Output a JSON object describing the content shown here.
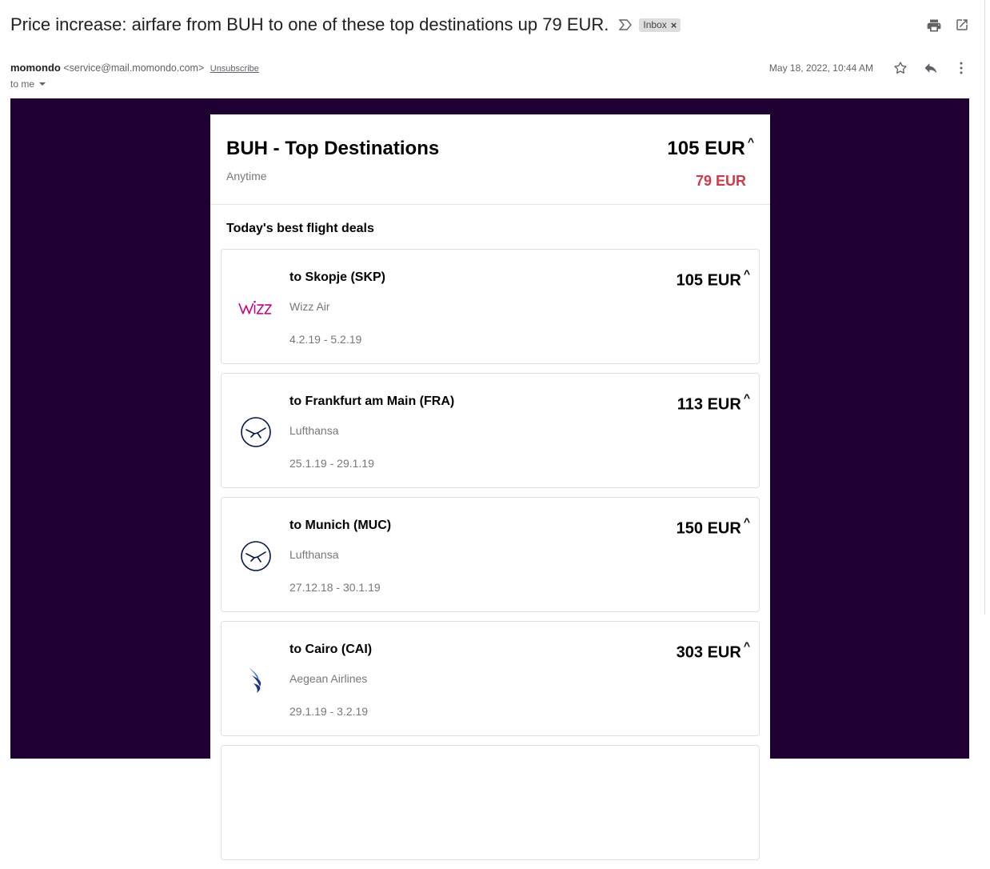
{
  "email": {
    "subject": "Price increase: airfare from BUH to one of these top destinations up 79 EUR.",
    "label_chip": "Inbox",
    "label_close": "×",
    "sender_name": "momondo",
    "sender_email": "<service@mail.momondo.com>",
    "unsubscribe": "Unsubscribe",
    "to": "to me",
    "date": "May 18, 2022, 10:44 AM",
    "icons": [
      "important-marker-icon",
      "print-icon",
      "open-new-window-icon",
      "star-icon",
      "reply-icon",
      "more-vert-icon"
    ]
  },
  "alert": {
    "title": "BUH - Top Destinations",
    "subtitle": "Anytime",
    "price": "105 EUR",
    "price_arrow": "^",
    "old_price": "79 EUR",
    "section_title": "Today's best flight deals",
    "colors": {
      "background": "#200033",
      "old_price": "#d03a48"
    }
  },
  "deals": [
    {
      "destination": "to Skopje (SKP)",
      "airline": "Wizz Air",
      "dates": "4.2.19 - 5.2.19",
      "price": "105 EUR",
      "arrow": "^",
      "logo": "wizz-air-logo"
    },
    {
      "destination": "to Frankfurt am Main (FRA)",
      "airline": "Lufthansa",
      "dates": "25.1.19 - 29.1.19",
      "price": "113 EUR",
      "arrow": "^",
      "logo": "lufthansa-logo"
    },
    {
      "destination": "to Munich (MUC)",
      "airline": "Lufthansa",
      "dates": "27.12.18 - 30.1.19",
      "price": "150 EUR",
      "arrow": "^",
      "logo": "lufthansa-logo"
    },
    {
      "destination": "to Cairo (CAI)",
      "airline": "Aegean Airlines",
      "dates": "29.1.19 - 3.2.19",
      "price": "303 EUR",
      "arrow": "^",
      "logo": "aegean-logo"
    }
  ]
}
